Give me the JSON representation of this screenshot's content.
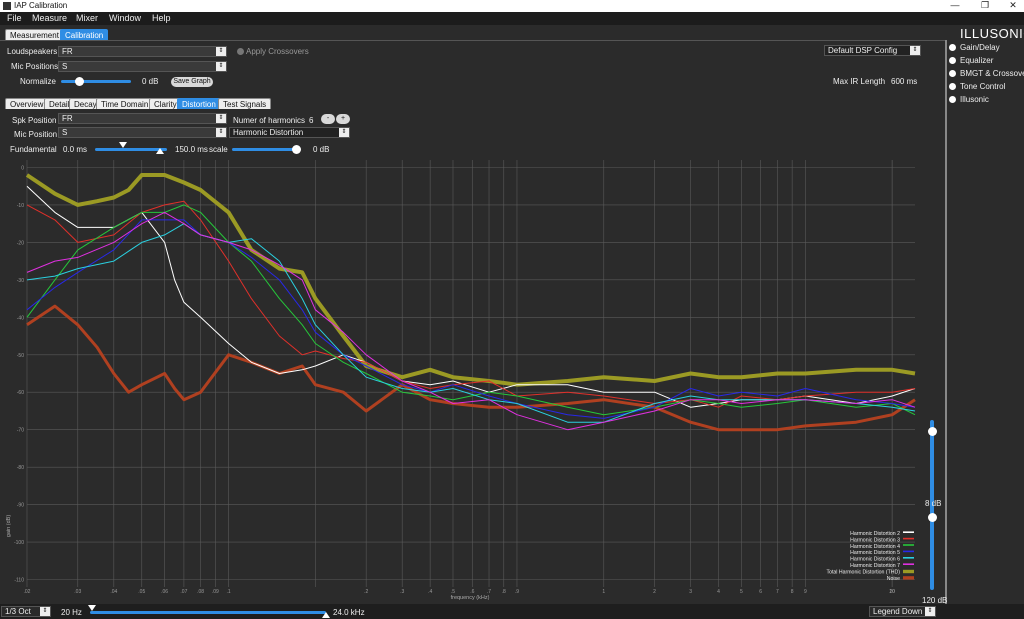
{
  "window": {
    "title": "IAP Calibration",
    "controls": [
      "—",
      "❐",
      "✕"
    ]
  },
  "menu": [
    "File",
    "Measure",
    "Mixer",
    "Window",
    "Help"
  ],
  "top_tabs": [
    "Measurement",
    "Calibration"
  ],
  "brand": "ILLUSONIC",
  "loudspeakers": {
    "label": "Loudspeakers",
    "value": "FR"
  },
  "mic_positions": {
    "label": "Mic Positions",
    "value": "S"
  },
  "apply_crossovers": "Apply Crossovers",
  "normalize": {
    "label": "Normalize",
    "value": "0 dB",
    "fraction": 0.25
  },
  "save_graph": "Save Graph",
  "dsp_config": "Default DSP Config",
  "max_ir": {
    "label": "Max IR Length",
    "value": "600 ms"
  },
  "right_panel": [
    "Gain/Delay",
    "Equalizer",
    "BMGT & Crossovers",
    "Tone Control",
    "Illusonic"
  ],
  "sub_tabs": [
    "Overview",
    "Detail",
    "Decay",
    "Time Domain",
    "Clarity",
    "Distortion",
    "Test Signals"
  ],
  "spk_position": {
    "label": "Spk Position",
    "value": "FR"
  },
  "mic_position": {
    "label": "Mic Position",
    "value": "S"
  },
  "harmonics": {
    "label": "Numer of harmonics",
    "value": "6",
    "minus": "-",
    "plus": "+"
  },
  "mode": "Harmonic Distortion",
  "fundamental": {
    "label": "Fundamental",
    "start": "0.0 ms",
    "end": "150.0 ms",
    "scale_label": "scale",
    "scale_value": "0 dB"
  },
  "right_slider": {
    "top": "8 dB",
    "bottom": "120 dB"
  },
  "bottom": {
    "octave": "1/3 Oct",
    "freq_min": "20 Hz",
    "freq_max": "24.0 kHz",
    "legend_mode": "Legend Down R"
  },
  "chart_data": {
    "type": "line",
    "xlabel": "frequency (kHz)",
    "ylabel": "gain (dB)",
    "x_scale": "log",
    "xlim": [
      0.02,
      24
    ],
    "ylim": [
      -112,
      2
    ],
    "yticks": [
      0,
      -10,
      -20,
      -30,
      -40,
      -50,
      -60,
      -70,
      -80,
      -90,
      -100,
      -110
    ],
    "xtick_labels": [
      ".02",
      ".03",
      ".04",
      ".05",
      ".06",
      ".07",
      ".08",
      ".09",
      ".1",
      "",
      ".2",
      ".3",
      ".4",
      ".5",
      ".6",
      ".7",
      ".8",
      ".9",
      "1",
      "2",
      "3",
      "4",
      "5",
      "6",
      "7",
      "8",
      "9",
      "10",
      "20"
    ],
    "grid": true,
    "legend_position": "bottom-right",
    "series": [
      {
        "name": "Harmonic Distortion 2",
        "color": "#ffffff",
        "width": 1,
        "x": [
          0.02,
          0.025,
          0.03,
          0.04,
          0.05,
          0.06,
          0.065,
          0.07,
          0.08,
          0.1,
          0.12,
          0.15,
          0.18,
          0.2,
          0.25,
          0.3,
          0.4,
          0.5,
          0.6,
          0.8,
          1,
          1.5,
          2,
          3,
          4,
          5,
          6,
          8,
          10,
          15,
          20,
          24
        ],
        "y": [
          -5,
          -12,
          -16,
          -16,
          -12,
          -20,
          -30,
          -36,
          -40,
          -47,
          -52,
          -55,
          -54,
          -53,
          -50,
          -52,
          -57,
          -58,
          -57,
          -60,
          -58,
          -58,
          -60,
          -60,
          -64,
          -63,
          -62,
          -62,
          -61,
          -63,
          -61,
          -59
        ]
      },
      {
        "name": "Harmonic Distortion 3",
        "color": "#e0302a",
        "width": 1,
        "x": [
          0.02,
          0.025,
          0.03,
          0.04,
          0.05,
          0.06,
          0.07,
          0.08,
          0.1,
          0.12,
          0.15,
          0.18,
          0.2,
          0.25,
          0.3,
          0.4,
          0.5,
          0.6,
          0.8,
          1,
          1.5,
          2,
          3,
          4,
          5,
          6,
          8,
          10,
          15,
          20,
          24
        ],
        "y": [
          -10,
          -14,
          -20,
          -18,
          -12,
          -10,
          -9,
          -14,
          -25,
          -35,
          -45,
          -50,
          -49,
          -51,
          -52,
          -57,
          -59,
          -58,
          -57,
          -61,
          -60,
          -61,
          -63,
          -62,
          -64,
          -61,
          -62,
          -61,
          -60,
          -60,
          -59
        ]
      },
      {
        "name": "Harmonic Distortion 4",
        "color": "#26c63a",
        "width": 1,
        "x": [
          0.02,
          0.025,
          0.03,
          0.04,
          0.05,
          0.06,
          0.07,
          0.08,
          0.1,
          0.12,
          0.15,
          0.18,
          0.2,
          0.25,
          0.3,
          0.4,
          0.5,
          0.6,
          0.8,
          1,
          1.5,
          2,
          3,
          4,
          5,
          6,
          8,
          10,
          15,
          20,
          24
        ],
        "y": [
          -40,
          -30,
          -22,
          -16,
          -12,
          -12,
          -10,
          -12,
          -20,
          -25,
          -35,
          -42,
          -47,
          -52,
          -55,
          -60,
          -61,
          -62,
          -60,
          -61,
          -64,
          -66,
          -64,
          -62,
          -63,
          -64,
          -63,
          -62,
          -64,
          -63,
          -66
        ]
      },
      {
        "name": "Harmonic Distortion 5",
        "color": "#2828e6",
        "width": 1,
        "x": [
          0.02,
          0.025,
          0.03,
          0.04,
          0.05,
          0.06,
          0.07,
          0.08,
          0.1,
          0.12,
          0.15,
          0.18,
          0.2,
          0.25,
          0.3,
          0.4,
          0.5,
          0.6,
          0.8,
          1,
          1.5,
          2,
          3,
          4,
          5,
          6,
          8,
          10,
          15,
          20,
          24
        ],
        "y": [
          -38,
          -32,
          -28,
          -22,
          -14,
          -14,
          -14,
          -18,
          -20,
          -24,
          -30,
          -38,
          -44,
          -50,
          -53,
          -58,
          -60,
          -58,
          -61,
          -63,
          -66,
          -67,
          -64,
          -59,
          -61,
          -60,
          -61,
          -59,
          -62,
          -63,
          -64
        ]
      },
      {
        "name": "Harmonic Distortion 6",
        "color": "#2ad0e0",
        "width": 1,
        "x": [
          0.02,
          0.025,
          0.03,
          0.04,
          0.05,
          0.06,
          0.07,
          0.08,
          0.1,
          0.12,
          0.15,
          0.18,
          0.2,
          0.25,
          0.3,
          0.4,
          0.5,
          0.6,
          0.8,
          1,
          1.5,
          2,
          3,
          4,
          5,
          6,
          8,
          10,
          15,
          20,
          24
        ],
        "y": [
          -30,
          -29,
          -27,
          -25,
          -20,
          -18,
          -15,
          -18,
          -20,
          -19,
          -25,
          -35,
          -42,
          -50,
          -56,
          -59,
          -60,
          -59,
          -62,
          -63,
          -68,
          -68,
          -63,
          -61,
          -62,
          -62,
          -62,
          -62,
          -63,
          -64,
          -65
        ]
      },
      {
        "name": "Harmonic Distortion 7",
        "color": "#e030e0",
        "width": 1,
        "x": [
          0.02,
          0.025,
          0.03,
          0.04,
          0.05,
          0.06,
          0.07,
          0.08,
          0.1,
          0.12,
          0.15,
          0.18,
          0.2,
          0.25,
          0.3,
          0.4,
          0.5,
          0.6,
          0.8,
          1,
          1.5,
          2,
          3,
          4,
          5,
          6,
          8,
          10,
          15,
          20,
          24
        ],
        "y": [
          -28,
          -25,
          -24,
          -20,
          -15,
          -12,
          -15,
          -18,
          -20,
          -22,
          -26,
          -30,
          -38,
          -44,
          -50,
          -57,
          -60,
          -63,
          -62,
          -66,
          -70,
          -68,
          -65,
          -62,
          -62,
          -63,
          -62,
          -62,
          -63,
          -62,
          -64
        ]
      },
      {
        "name": "Total Harmonic Distortion (THD)",
        "color": "#9b9a24",
        "width": 4,
        "x": [
          0.02,
          0.025,
          0.03,
          0.035,
          0.04,
          0.045,
          0.05,
          0.06,
          0.07,
          0.08,
          0.1,
          0.12,
          0.15,
          0.18,
          0.2,
          0.25,
          0.3,
          0.4,
          0.5,
          0.6,
          0.8,
          1,
          1.5,
          2,
          3,
          4,
          5,
          6,
          8,
          10,
          15,
          20,
          24
        ],
        "y": [
          -2,
          -7,
          -10,
          -9,
          -8,
          -6,
          -2,
          -2,
          -4,
          -6,
          -12,
          -22,
          -27,
          -28,
          -35,
          -45,
          -53,
          -56,
          -54,
          -56,
          -57,
          -58,
          -57,
          -56,
          -57,
          -55,
          -56,
          -56,
          -55,
          -55,
          -54,
          -54,
          -55
        ]
      },
      {
        "name": "Noise",
        "color": "#b04020",
        "width": 3,
        "x": [
          0.02,
          0.025,
          0.03,
          0.035,
          0.04,
          0.045,
          0.05,
          0.06,
          0.065,
          0.07,
          0.08,
          0.1,
          0.12,
          0.15,
          0.18,
          0.2,
          0.25,
          0.3,
          0.4,
          0.5,
          0.6,
          0.8,
          1,
          1.5,
          2,
          3,
          4,
          5,
          6,
          8,
          10,
          15,
          20,
          24
        ],
        "y": [
          -42,
          -37,
          -42,
          -48,
          -55,
          -60,
          -58,
          -55,
          -59,
          -62,
          -60,
          -50,
          -52,
          -55,
          -53,
          -58,
          -60,
          -65,
          -58,
          -62,
          -63,
          -64,
          -64,
          -63,
          -62,
          -64,
          -68,
          -70,
          -70,
          -70,
          -69,
          -68,
          -66,
          -62
        ]
      }
    ]
  }
}
